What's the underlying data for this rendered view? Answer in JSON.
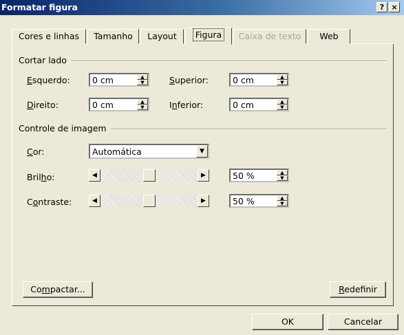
{
  "window": {
    "title": "Formatar figura",
    "help_glyph": "?",
    "close_glyph": "×"
  },
  "tabs": [
    {
      "label": "Cores e linhas",
      "active": false,
      "disabled": false
    },
    {
      "label": "Tamanho",
      "active": false,
      "disabled": false
    },
    {
      "label": "Layout",
      "active": false,
      "disabled": false
    },
    {
      "label": "Figura",
      "active": true,
      "disabled": false
    },
    {
      "label": "Caixa de texto",
      "active": false,
      "disabled": true
    },
    {
      "label": "Web",
      "active": false,
      "disabled": false
    }
  ],
  "crop": {
    "title": "Cortar lado",
    "left": {
      "label_ul": "E",
      "label_rest": "squerdo:",
      "value": "0 cm"
    },
    "right": {
      "label_ul": "D",
      "label_rest": "ireito:",
      "value": "0 cm"
    },
    "top": {
      "label_ul": "S",
      "label_rest": "uperior:",
      "value": "0 cm"
    },
    "bottom": {
      "label_pre": "I",
      "label_ul": "n",
      "label_rest": "ferior:",
      "value": "0 cm"
    }
  },
  "image_control": {
    "title": "Controle de imagem",
    "color": {
      "label_ul": "C",
      "label_rest": "or:",
      "value": "Automática"
    },
    "brightness": {
      "label_pre": "Bril",
      "label_ul": "h",
      "label_rest": "o:",
      "value": "50 %",
      "level": 0.5
    },
    "contrast": {
      "label_pre": "C",
      "label_ul": "o",
      "label_rest": "ntraste:",
      "value": "50 %",
      "level": 0.5
    }
  },
  "buttons": {
    "compress_pre": "Co",
    "compress_ul": "m",
    "compress_rest": "pactar...",
    "reset_ul": "R",
    "reset_rest": "edefinir",
    "ok": "OK",
    "cancel": "Cancelar"
  },
  "glyphs": {
    "up": "▲",
    "down": "▼",
    "left": "◀",
    "right": "▶"
  }
}
